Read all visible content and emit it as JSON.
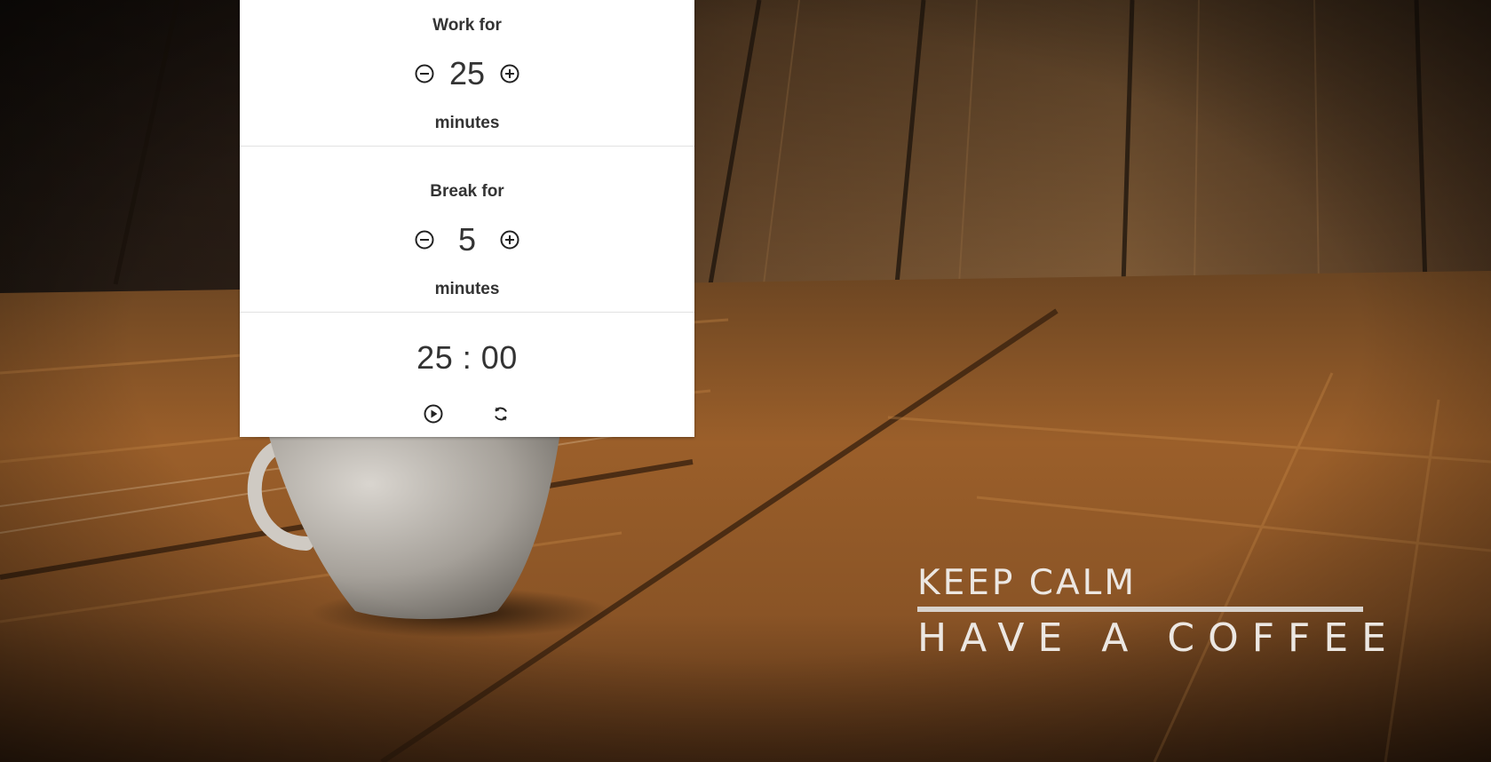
{
  "work": {
    "label": "Work for",
    "value": "25",
    "unit": "minutes"
  },
  "break": {
    "label": "Break for",
    "value": "5",
    "unit": "minutes"
  },
  "timer": {
    "minutes": "25",
    "separator": ":",
    "seconds": "00"
  },
  "slogan": {
    "line1": "KEEP CALM",
    "line2": "HAVE A COFFEE"
  },
  "icons": {
    "decrement": "minus-circle-icon",
    "increment": "plus-circle-icon",
    "play": "play-circle-icon",
    "reset": "refresh-icon"
  },
  "colors": {
    "panel": "#ffffff",
    "text": "#333333",
    "slogan": "#ece7e2"
  }
}
